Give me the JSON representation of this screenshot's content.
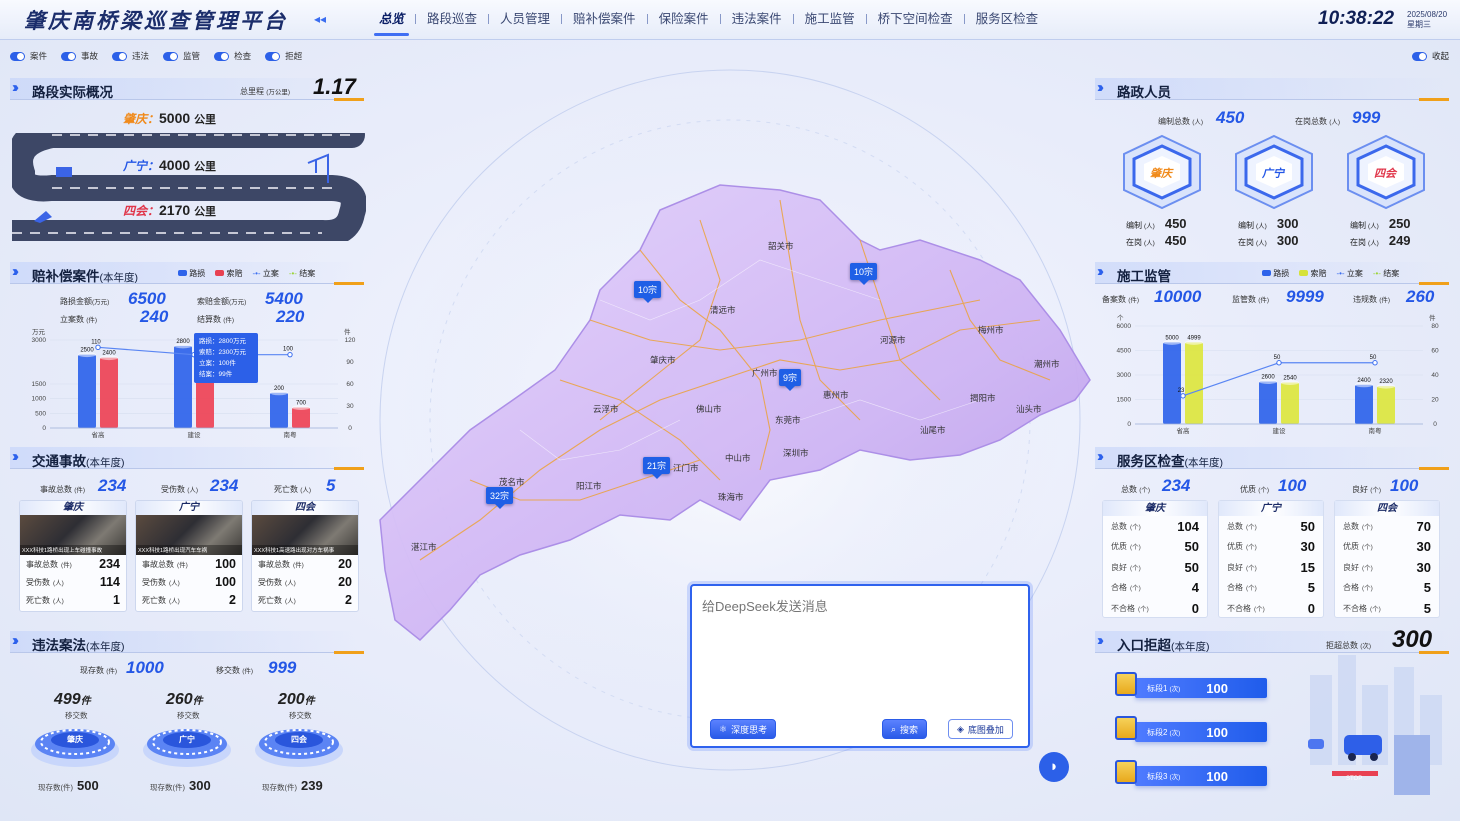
{
  "header": {
    "title": "肇庆南桥梁巡查管理平台",
    "collapse": "◂◂",
    "nav": [
      "总览",
      "路段巡查",
      "人员管理",
      "赔补偿案件",
      "保险案件",
      "违法案件",
      "施工监管",
      "桥下空间检查",
      "服务区检查"
    ],
    "time": "10:38:22",
    "date": "2025/08/20",
    "weekday": "星期三"
  },
  "toggles": [
    "案件",
    "事故",
    "违法",
    "监管",
    "检查",
    "拒超"
  ],
  "collect": "收起",
  "road": {
    "title": "路段实际概况",
    "total_label": "总里程",
    "total_unit": "(万公里)",
    "total": "1.17",
    "items": [
      {
        "name": "肇庆：",
        "value": "5000",
        "unit": "公里"
      },
      {
        "name": "广宁：",
        "value": "4000",
        "unit": "公里"
      },
      {
        "name": "四会：",
        "value": "2170",
        "unit": "公里"
      }
    ]
  },
  "comp": {
    "title": "赔补偿案件",
    "suffix": "(本年度)",
    "legend": [
      "路损",
      "索赔",
      "立案",
      "结案"
    ],
    "stats": [
      {
        "label": "路损金额",
        "unit": "(万元)",
        "value": "6500"
      },
      {
        "label": "索赔金额",
        "unit": "(万元)",
        "value": "5400"
      },
      {
        "label": "立案数",
        "unit": "(件)",
        "value": "240"
      },
      {
        "label": "结算数",
        "unit": "(件)",
        "value": "220"
      }
    ],
    "tooltip": [
      "路损：2800万元",
      "索赔：2300万元",
      "立案：100件",
      "结案：99件"
    ]
  },
  "chart_data": [
    {
      "type": "bar",
      "title": "赔补偿案件",
      "ylabel": "万元",
      "y2label": "件",
      "ylim": [
        0,
        3000
      ],
      "y2lim": [
        0,
        120
      ],
      "yticks": [
        0,
        500,
        1000,
        1500,
        3000
      ],
      "y2ticks": [
        0,
        30,
        60,
        90,
        120
      ],
      "categories": [
        "省高",
        "建设",
        "南粤"
      ],
      "series": [
        {
          "name": "路损",
          "values": [
            2500,
            2800,
            1200
          ]
        },
        {
          "name": "索赔",
          "values": [
            2400,
            2300,
            700
          ]
        },
        {
          "name": "立案",
          "values": [
            110,
            100,
            100
          ]
        }
      ],
      "labels": [
        [
          "2500",
          "2400",
          "110"
        ],
        [
          "2800",
          "",
          ""
        ],
        [
          "200",
          "700",
          "100"
        ]
      ]
    },
    {
      "type": "bar",
      "title": "施工监管",
      "ylabel": "个",
      "y2label": "件",
      "ylim": [
        0,
        6000
      ],
      "y2lim": [
        0,
        80
      ],
      "yticks": [
        0,
        1500,
        3000,
        4500,
        6000
      ],
      "y2ticks": [
        0,
        20,
        40,
        60,
        80
      ],
      "categories": [
        "省高",
        "建设",
        "南粤"
      ],
      "series": [
        {
          "name": "路损",
          "values": [
            5000,
            2600,
            2400
          ]
        },
        {
          "name": "索赔",
          "values": [
            4999,
            2540,
            2320
          ]
        },
        {
          "name": "立案",
          "values": [
            23,
            50,
            50
          ]
        }
      ],
      "labels": [
        [
          "5000",
          "4999",
          "23"
        ],
        [
          "2600",
          "2540",
          "50"
        ],
        [
          "2400",
          "2320",
          "50"
        ]
      ]
    }
  ],
  "accident": {
    "title": "交通事故",
    "suffix": "(本年度)",
    "stats": [
      {
        "label": "事故总数",
        "unit": "(件)",
        "value": "234"
      },
      {
        "label": "受伤数",
        "unit": "(人)",
        "value": "234"
      },
      {
        "label": "死亡数",
        "unit": "(人)",
        "value": "5"
      }
    ],
    "cards": [
      {
        "name": "肇庆",
        "caption": "XXX科技1路桥出现上车碰撞事故",
        "rows": [
          [
            "事故总数",
            "(件)",
            "234"
          ],
          [
            "受伤数",
            "(人)",
            "114"
          ],
          [
            "死亡数",
            "(人)",
            "1"
          ]
        ]
      },
      {
        "name": "广宁",
        "caption": "XXX科技1路桥出现汽车车祸",
        "rows": [
          [
            "事故总数",
            "(件)",
            "100"
          ],
          [
            "受伤数",
            "(人)",
            "100"
          ],
          [
            "死亡数",
            "(人)",
            "2"
          ]
        ]
      },
      {
        "name": "四会",
        "caption": "XXX科技1高速路出现对方车祸事",
        "rows": [
          [
            "事故总数",
            "(件)",
            "20"
          ],
          [
            "受伤数",
            "(人)",
            "20"
          ],
          [
            "死亡数",
            "(人)",
            "2"
          ]
        ]
      }
    ]
  },
  "law": {
    "title": "违法案法",
    "suffix": "(本年度)",
    "stats": [
      {
        "label": "现存数",
        "unit": "(件)",
        "value": "1000"
      },
      {
        "label": "移交数",
        "unit": "(件)",
        "value": "999"
      }
    ],
    "rings": [
      {
        "value": "499",
        "unit": "件",
        "sub": "移交数",
        "name": "肇庆",
        "foot": "现存数(件)",
        "foot_value": "500"
      },
      {
        "value": "260",
        "unit": "件",
        "sub": "移交数",
        "name": "广宁",
        "foot": "现存数(件)",
        "foot_value": "300"
      },
      {
        "value": "200",
        "unit": "件",
        "sub": "移交数",
        "name": "四会",
        "foot": "现存数(件)",
        "foot_value": "239"
      }
    ]
  },
  "staff": {
    "title": "路政人员",
    "stats": [
      {
        "label": "编制总数",
        "unit": "(人)",
        "value": "450"
      },
      {
        "label": "在岗总数",
        "unit": "(人)",
        "value": "999"
      }
    ],
    "hexes": [
      {
        "name": "肇庆",
        "a": [
          "编制",
          "(人)",
          "450"
        ],
        "b": [
          "在岗",
          "(人)",
          "450"
        ]
      },
      {
        "name": "广宁",
        "a": [
          "编制",
          "(人)",
          "300"
        ],
        "b": [
          "在岗",
          "(人)",
          "300"
        ]
      },
      {
        "name": "四会",
        "a": [
          "编制",
          "(人)",
          "250"
        ],
        "b": [
          "在岗",
          "(人)",
          "249"
        ]
      }
    ]
  },
  "construct": {
    "title": "施工监管",
    "legend": [
      "路损",
      "索赔",
      "立案",
      "结案"
    ],
    "stats": [
      {
        "label": "备案数",
        "unit": "(件)",
        "value": "10000"
      },
      {
        "label": "监管数",
        "unit": "(件)",
        "value": "9999"
      },
      {
        "label": "违规数",
        "unit": "(件)",
        "value": "260"
      }
    ]
  },
  "service": {
    "title": "服务区检查",
    "suffix": "(本年度)",
    "stats": [
      {
        "label": "总数",
        "unit": "(个)",
        "value": "234"
      },
      {
        "label": "优质",
        "unit": "(个)",
        "value": "100"
      },
      {
        "label": "良好",
        "unit": "(个)",
        "value": "100"
      }
    ],
    "cards": [
      {
        "name": "肇庆",
        "rows": [
          [
            "总数",
            "(个)",
            "104"
          ],
          [
            "优质",
            "(个)",
            "50"
          ],
          [
            "良好",
            "(个)",
            "50"
          ],
          [
            "合格",
            "(个)",
            "4"
          ],
          [
            "不合格",
            "(个)",
            "0"
          ]
        ]
      },
      {
        "name": "广宁",
        "rows": [
          [
            "总数",
            "(个)",
            "50"
          ],
          [
            "优质",
            "(个)",
            "30"
          ],
          [
            "良好",
            "(个)",
            "15"
          ],
          [
            "合格",
            "(个)",
            "5"
          ],
          [
            "不合格",
            "(个)",
            "0"
          ]
        ]
      },
      {
        "name": "四会",
        "rows": [
          [
            "总数",
            "(个)",
            "70"
          ],
          [
            "优质",
            "(个)",
            "30"
          ],
          [
            "良好",
            "(个)",
            "30"
          ],
          [
            "合格",
            "(个)",
            "5"
          ],
          [
            "不合格",
            "(个)",
            "5"
          ]
        ]
      }
    ]
  },
  "reject": {
    "title": "入口拒超",
    "suffix": "(本年度)",
    "total_label": "拒超总数",
    "total_unit": "(次)",
    "total": "300",
    "rows": [
      {
        "name": "标段1",
        "unit": "(次)",
        "value": "100"
      },
      {
        "name": "标段2",
        "unit": "(次)",
        "value": "100"
      },
      {
        "name": "标段3",
        "unit": "(次)",
        "value": "100"
      }
    ],
    "stop": "STOP"
  },
  "map": {
    "cities": [
      "韶关市",
      "清远市",
      "肇庆市",
      "广州市",
      "河源市",
      "梅州市",
      "潮州市",
      "惠州市",
      "揭阳市",
      "汕头市",
      "云浮市",
      "佛山市",
      "东莞市",
      "汕尾市",
      "深圳市",
      "中山市",
      "江门市",
      "茂名市",
      "阳江市",
      "珠海市",
      "湛江市"
    ],
    "pins": [
      "10宗",
      "10宗",
      "9宗",
      "21宗",
      "32宗"
    ]
  },
  "chat": {
    "placeholder": "给DeepSeek发送消息",
    "deep": "深度思考",
    "search": "搜索",
    "layer": "底图叠加"
  }
}
